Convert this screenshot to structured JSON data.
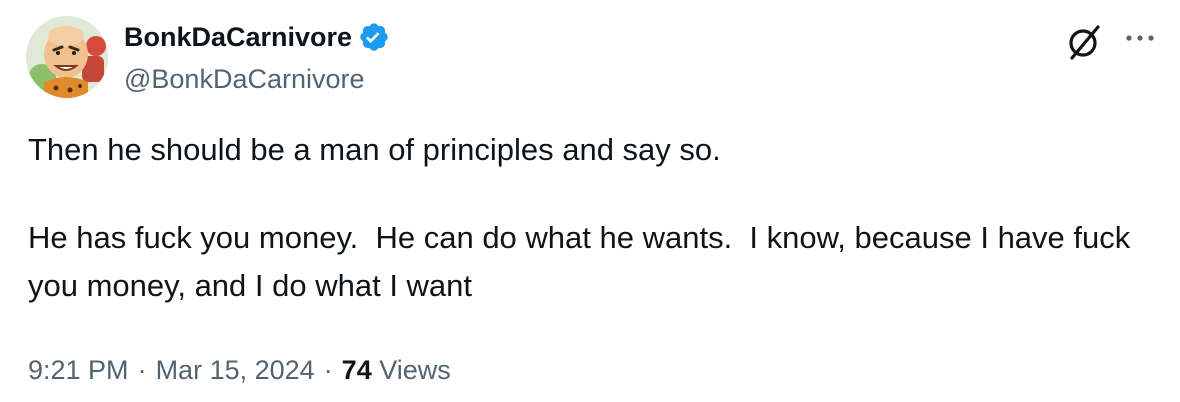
{
  "author": {
    "display_name": "BonkDaCarnivore",
    "handle": "@BonkDaCarnivore",
    "verified": true,
    "verified_color": "#1d9bf0"
  },
  "header_actions": {
    "grok_icon": "grok-icon",
    "more_icon": "more-horizontal-icon"
  },
  "tweet": {
    "paragraphs": [
      "Then he should be a man of principles and say so.",
      "He has fuck you money.  He can do what he wants.  I know, because I have fuck you money, and I do what I want"
    ]
  },
  "meta": {
    "time": "9:21 PM",
    "separator": "·",
    "date": "Mar 15, 2024",
    "views_count": "74",
    "views_label": "Views"
  }
}
